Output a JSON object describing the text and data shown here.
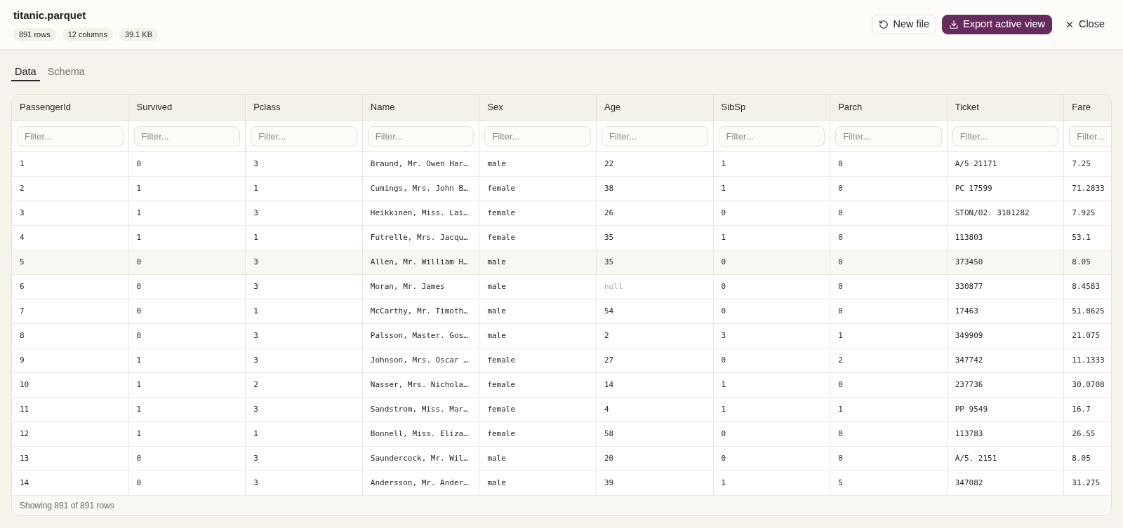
{
  "file": {
    "title": "titanic.parquet",
    "badges": [
      "891 rows",
      "12 columns",
      "39.1 KB"
    ]
  },
  "actions": [
    {
      "kind": "outline",
      "label": "New file"
    },
    {
      "kind": "primary",
      "label": "Export active view"
    },
    {
      "kind": "ghost",
      "label": "Close"
    }
  ],
  "tabs": [
    {
      "label": "Data",
      "selected": true
    },
    {
      "label": "Schema",
      "selected": false
    }
  ],
  "table": {
    "columns": [
      {
        "label": "PassengerId",
        "filter_placeholder": "Filter..."
      },
      {
        "label": "Survived",
        "filter_placeholder": "Filter..."
      },
      {
        "label": "Pclass",
        "filter_placeholder": "Filter..."
      },
      {
        "label": "Name",
        "filter_placeholder": "Filter..."
      },
      {
        "label": "Sex",
        "filter_placeholder": "Filter..."
      },
      {
        "label": "Age",
        "filter_placeholder": "Filter..."
      },
      {
        "label": "SibSp",
        "filter_placeholder": "Filter..."
      },
      {
        "label": "Parch",
        "filter_placeholder": "Filter..."
      },
      {
        "label": "Ticket",
        "filter_placeholder": "Filter..."
      },
      {
        "label": "Fare",
        "filter_placeholder": "Filter..."
      }
    ],
    "rows": [
      {
        "highlighted": false,
        "cells": [
          "1",
          "0",
          "3",
          "Braund, Mr. Owen Har…",
          "male",
          "22",
          "1",
          "0",
          "A/5 21171",
          "7.25"
        ]
      },
      {
        "highlighted": false,
        "cells": [
          "2",
          "1",
          "1",
          "Cumings, Mrs. John B…",
          "female",
          "38",
          "1",
          "0",
          "PC 17599",
          "71.2833"
        ]
      },
      {
        "highlighted": false,
        "cells": [
          "3",
          "1",
          "3",
          "Heikkinen, Miss. Lai…",
          "female",
          "26",
          "0",
          "0",
          "STON/O2. 3101282",
          "7.925"
        ]
      },
      {
        "highlighted": false,
        "cells": [
          "4",
          "1",
          "1",
          "Futrelle, Mrs. Jacqu…",
          "female",
          "35",
          "1",
          "0",
          "113803",
          "53.1"
        ]
      },
      {
        "highlighted": true,
        "cells": [
          "5",
          "0",
          "3",
          "Allen, Mr. William H…",
          "male",
          "35",
          "0",
          "0",
          "373450",
          "8.05"
        ]
      },
      {
        "highlighted": false,
        "cells": [
          "6",
          "0",
          "3",
          "Moran, Mr. James",
          "male",
          {
            "text": "null",
            "is_null": true
          },
          "0",
          "0",
          "330877",
          "8.4583"
        ]
      },
      {
        "highlighted": false,
        "cells": [
          "7",
          "0",
          "1",
          "McCarthy, Mr. Timoth…",
          "male",
          "54",
          "0",
          "0",
          "17463",
          "51.8625"
        ]
      },
      {
        "highlighted": false,
        "cells": [
          "8",
          "0",
          "3",
          "Palsson, Master. Gos…",
          "male",
          "2",
          "3",
          "1",
          "349909",
          "21.075"
        ]
      },
      {
        "highlighted": false,
        "cells": [
          "9",
          "1",
          "3",
          "Johnson, Mrs. Oscar …",
          "female",
          "27",
          "0",
          "2",
          "347742",
          "11.1333"
        ]
      },
      {
        "highlighted": false,
        "cells": [
          "10",
          "1",
          "2",
          "Nasser, Mrs. Nichola…",
          "female",
          "14",
          "1",
          "0",
          "237736",
          "30.0708"
        ]
      },
      {
        "highlighted": false,
        "cells": [
          "11",
          "1",
          "3",
          "Sandstrom, Miss. Mar…",
          "female",
          "4",
          "1",
          "1",
          "PP 9549",
          "16.7"
        ]
      },
      {
        "highlighted": false,
        "cells": [
          "12",
          "1",
          "1",
          "Bonnell, Miss. Eliza…",
          "female",
          "58",
          "0",
          "0",
          "113783",
          "26.55"
        ]
      },
      {
        "highlighted": false,
        "cells": [
          "13",
          "0",
          "3",
          "Saundercock, Mr. Wil…",
          "male",
          "20",
          "0",
          "0",
          "A/5. 2151",
          "8.05"
        ]
      },
      {
        "highlighted": false,
        "cells": [
          "14",
          "0",
          "3",
          "Andersson, Mr. Ander…",
          "male",
          "39",
          "1",
          "5",
          "347082",
          "31.275"
        ]
      }
    ],
    "footer": "Showing 891 of 891 rows"
  }
}
